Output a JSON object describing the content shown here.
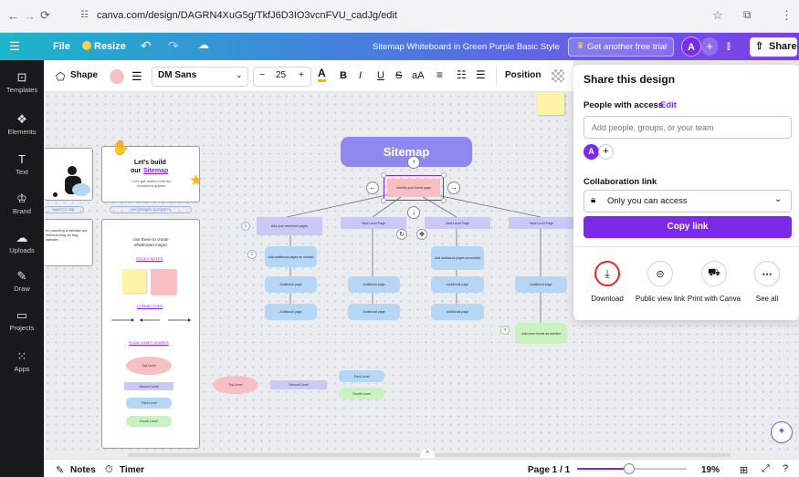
{
  "browser": {
    "url": "canva.com/design/DAGRN4XuG5g/TkfJ6D3IO3vcnFVU_cadJg/edit"
  },
  "header": {
    "menu_icon": "hamburger-icon",
    "file_label": "File",
    "resize_label": "Resize",
    "design_title": "Sitemap Whiteboard in Green Purple Basic Style",
    "trial_label": "Get another free trial",
    "avatar_letter": "A",
    "share_label": "Share"
  },
  "sidebar": {
    "items": [
      {
        "label": "Templates",
        "icon": "templates-icon"
      },
      {
        "label": "Elements",
        "icon": "elements-icon"
      },
      {
        "label": "Text",
        "icon": "text-icon"
      },
      {
        "label": "Brand",
        "icon": "brand-icon"
      },
      {
        "label": "Uploads",
        "icon": "uploads-icon"
      },
      {
        "label": "Draw",
        "icon": "draw-icon"
      },
      {
        "label": "Projects",
        "icon": "projects-icon"
      },
      {
        "label": "Apps",
        "icon": "apps-icon"
      }
    ]
  },
  "toolbar": {
    "shape_label": "Shape",
    "font_family": "DM Sans",
    "font_size": "25",
    "minus": "−",
    "plus": "+",
    "text_color": "A",
    "bold": "B",
    "italic": "I",
    "underline": "U",
    "strike": "S",
    "case": "aA",
    "position_label": "Position"
  },
  "canvas": {
    "left_card": {
      "title_line1": "Let's build",
      "title_line2": "our",
      "title_link": "Sitemap",
      "subtitle": "Let's get started with the numbered guides.",
      "tag1": "WHEN TO USE",
      "tag2": "WHITEBOARD ELEMENTS",
      "left_snippet": "en planning a website om restructuring an ting website.",
      "magic_text": "Use these to create whiteboard magic!",
      "sticky_notes": "STICKY NOTES",
      "connectors": "CONNECTORS",
      "flow_chart": "FLOW CHART SHAPES",
      "shapes": [
        "Top Level",
        "Second Level",
        "Third Level",
        "Fourth Level"
      ]
    },
    "sitemap_title": "Sitemap",
    "home_box": "Identify your home page",
    "level2": [
      "Add your next level pages",
      "Next Level Page",
      "Next Level Page",
      "Next Level Page"
    ],
    "add_pages": [
      "Add additional pages as needed",
      "Add additional pages as needed"
    ],
    "additional": "Additional page",
    "add_levels": "Add more levels as needed",
    "step_numbers": [
      "2",
      "3",
      "4"
    ],
    "legend": [
      "Top Level",
      "Second Level",
      "Third Level",
      "Fourth Level"
    ]
  },
  "share_panel": {
    "title": "Share this design",
    "people_label": "People with access",
    "edit_label": "Edit",
    "people_placeholder": "Add people, groups, or your team",
    "avatar_letter": "A",
    "collab_label": "Collaboration link",
    "access_value": "Only you can access",
    "copy_link": "Copy link",
    "actions": [
      {
        "label": "Download",
        "icon": "download-icon"
      },
      {
        "label": "Public view link",
        "icon": "link-icon"
      },
      {
        "label": "Print with Canva",
        "icon": "truck-icon"
      },
      {
        "label": "See all",
        "icon": "more-icon"
      }
    ]
  },
  "bottom": {
    "notes": "Notes",
    "timer": "Timer",
    "page": "Page 1 / 1",
    "zoom": "19%",
    "zoom_fraction": 0.19
  },
  "colors": {
    "accent_purple": "#7d2ae8",
    "highlight_red": "#e0292b"
  }
}
